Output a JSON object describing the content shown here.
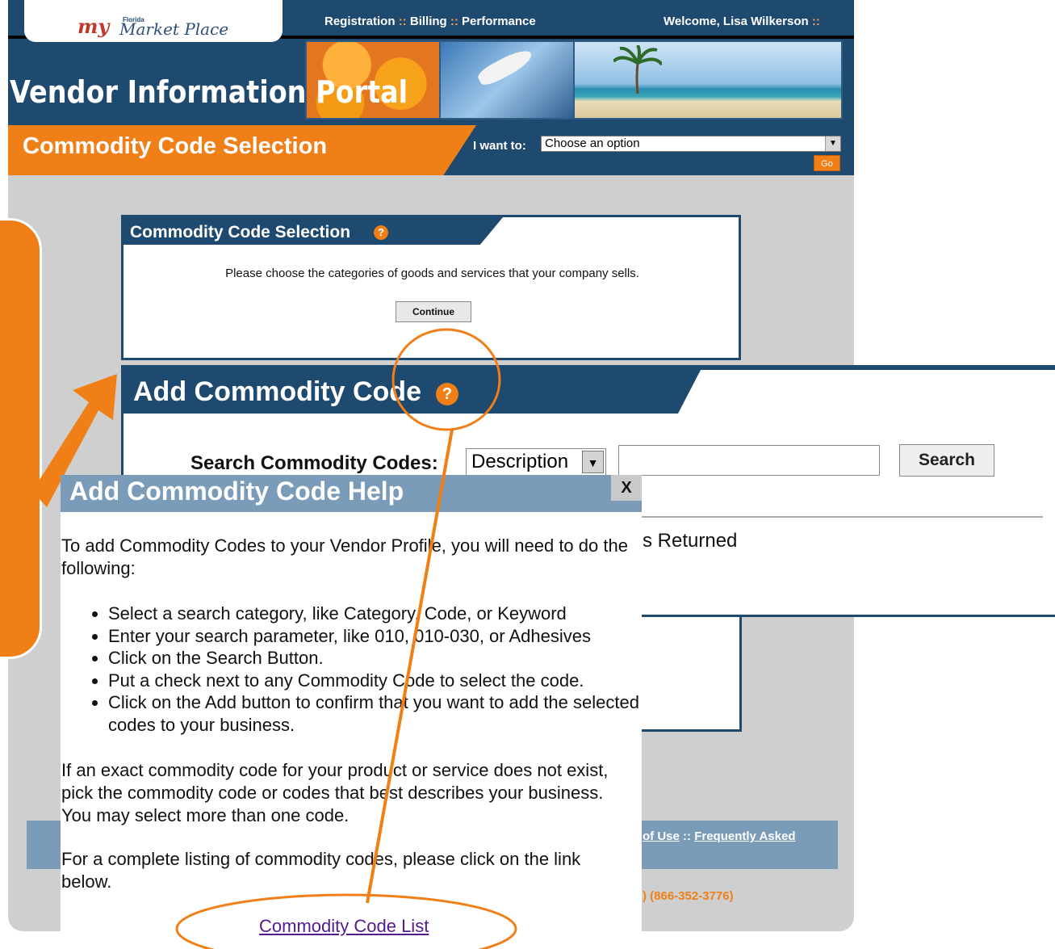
{
  "header": {
    "logo_my": "my",
    "logo_florida": "Florida",
    "logo_marketplace": "Market Place",
    "nav": [
      "Registration",
      "Billing",
      "Performance"
    ],
    "nav_separator": "::",
    "welcome": "Welcome, Lisa Wilkerson",
    "welcome_separator": "::",
    "portal_title": "Vendor Information Portal"
  },
  "page": {
    "title": "Commodity Code Selection",
    "i_want_to_label": "I want to:",
    "i_want_to_value": "Choose an option",
    "go_label": "Go"
  },
  "selection_panel": {
    "title": "Commodity Code Selection",
    "help_glyph": "?",
    "description": "Please choose the categories of goods and services that your company sells.",
    "continue_label": "Continue"
  },
  "add_panel": {
    "title": "Add Commodity Code",
    "help_glyph": "?",
    "search_label": "Search Commodity Codes:",
    "search_type_value": "Description",
    "search_input_value": "",
    "search_button": "Search",
    "results_text": "s Returned"
  },
  "help_popup": {
    "title": "Add Commodity Code Help",
    "close_label": "X",
    "intro": "To add Commodity Codes to your Vendor Profile, you will need to do the following:",
    "steps": [
      "Select a search category, like Category, Code, or Keyword",
      "Enter your search parameter, like 010, 010-030, or Adhesives",
      "Click on the Search Button.",
      "Put a check next to any Commodity Code to select the code.",
      "Click on the Add button to confirm that you want to add the selected codes to your business."
    ],
    "paragraph2": "If an exact commodity code for your product or service does not exist, pick the commodity code or codes that best describes your business. You may select more than one code.",
    "paragraph3": "For a complete listing of commodity codes, please click on the link below.",
    "link_label": "Commodity Code List"
  },
  "footer": {
    "link_partial_1": "of Use",
    "separator": "::",
    "link_partial_2": "Frequently Asked",
    "phone_partial": ") (866-352-3776)"
  },
  "colors": {
    "navy": "#1f4a70",
    "orange": "#f07f18",
    "steel_blue": "#7b9cb9",
    "page_gray": "#cfcfcf"
  }
}
